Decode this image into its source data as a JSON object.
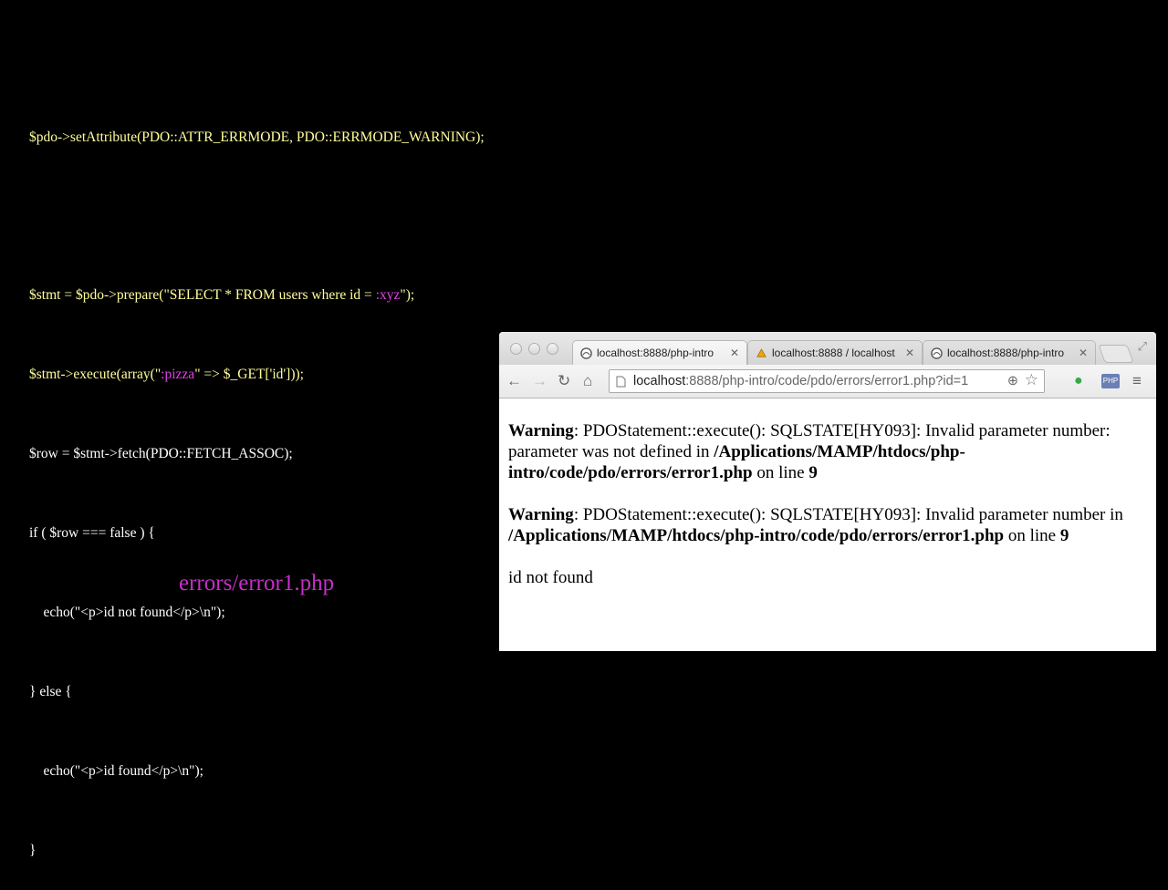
{
  "slide": {
    "code": {
      "l1_var": "$pdo->",
      "l1_call": "setAttribute(PDO::ATTR_ERRMODE, PDO::ERRMODE_WARNING);",
      "l2_a": "$stmt = $pdo->prepare(\"SELECT * FROM users where id = ",
      "l2_param": ":xyz",
      "l2_b": "\");",
      "l3_a": "$stmt->execute(array(\"",
      "l3_param": ":pizza",
      "l3_b": "\" => $_GET['id']));",
      "l4": "$row = $stmt->fetch(PDO::FETCH_ASSOC);",
      "l5": "if ( $row === false ) {",
      "l6": "    echo(\"<p>id not found</p>\\n\");",
      "l7": "} else {",
      "l8": "    echo(\"<p>id found</p>\\n\");",
      "l9": "}"
    },
    "caption": "errors/error1.php"
  },
  "browser": {
    "tabs": [
      {
        "title": "localhost:8888/php-intro",
        "icon": "globe-icon"
      },
      {
        "title": "localhost:8888 / localhost",
        "icon": "phpmyadmin-icon"
      },
      {
        "title": "localhost:8888/php-intro",
        "icon": "globe-icon"
      }
    ],
    "url_host": "localhost",
    "url_rest": ":8888/php-intro/code/pdo/errors/error1.php?id=1",
    "content": {
      "warn1_label": "Warning",
      "warn1_text": ": PDOStatement::execute(): SQLSTATE[HY093]: Invalid parameter number: parameter was not defined in ",
      "warn1_path": "/Applications/MAMP/htdocs/php-intro/code/pdo/errors/error1.php",
      "warn1_online": " on line ",
      "warn1_line": "9",
      "warn2_label": "Warning",
      "warn2_text": ": PDOStatement::execute(): SQLSTATE[HY093]: Invalid parameter number in ",
      "warn2_path": "/Applications/MAMP/htdocs/php-intro/code/pdo/errors/error1.php",
      "warn2_online": " on line ",
      "warn2_line": "9",
      "result": "id not found"
    }
  }
}
